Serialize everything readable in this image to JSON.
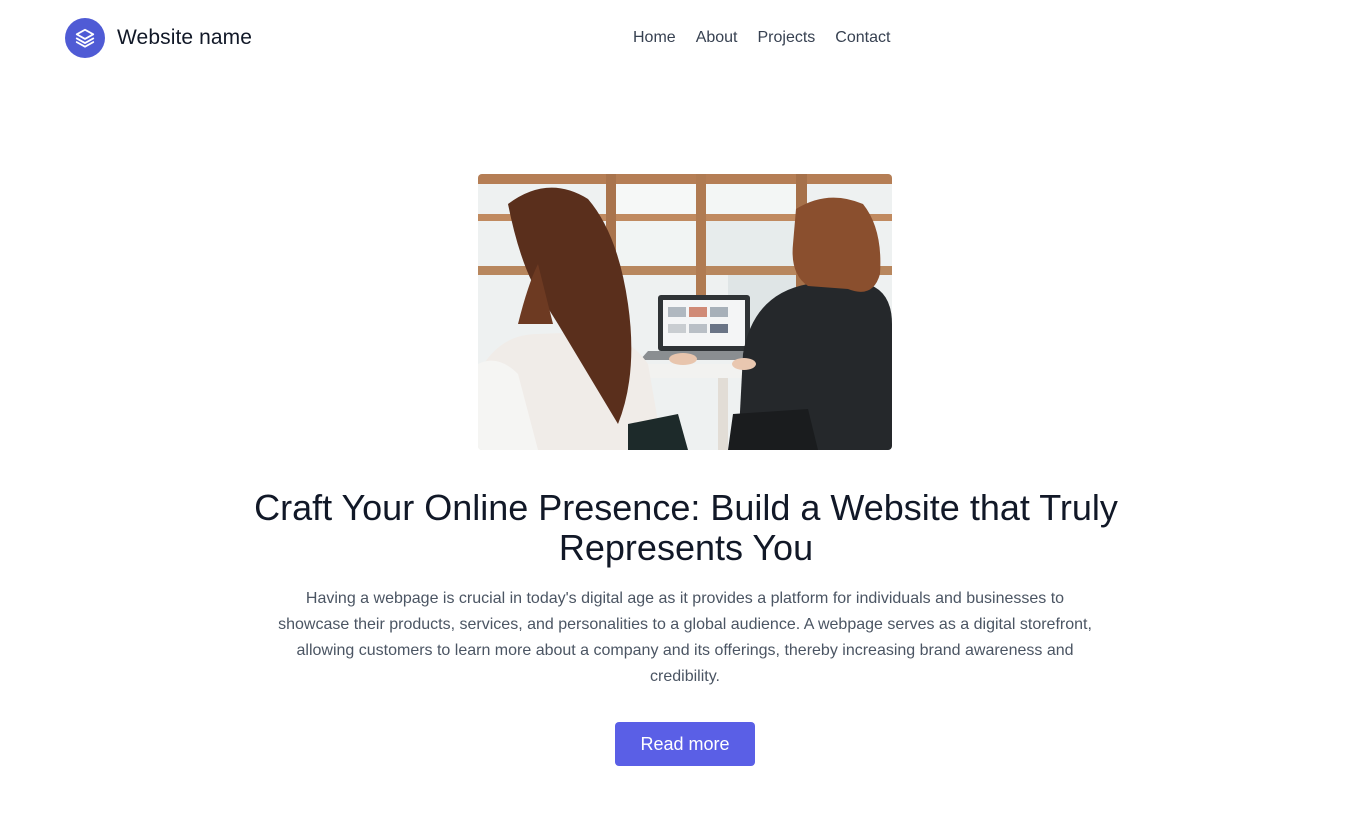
{
  "header": {
    "brand_name": "Website name",
    "logo_icon": "layers-icon",
    "nav": [
      {
        "label": "Home"
      },
      {
        "label": "About"
      },
      {
        "label": "Projects"
      },
      {
        "label": "Contact"
      }
    ]
  },
  "hero": {
    "image_icon": "photo",
    "title": "Craft Your Online Presence: Build a Website that Truly Represents You",
    "description": "Having a webpage is crucial in today's digital age as it provides a platform for individuals and businesses to showcase their products, services, and personalities to a global audience. A webpage serves as a digital storefront, allowing customers to learn more about a company and its offerings, thereby increasing brand awareness and credibility.",
    "button_label": "Read more"
  },
  "colors": {
    "accent": "#5a5fe6",
    "logo_bg": "#4f5bd5",
    "heading": "#111827",
    "body_text": "#4b5563"
  }
}
